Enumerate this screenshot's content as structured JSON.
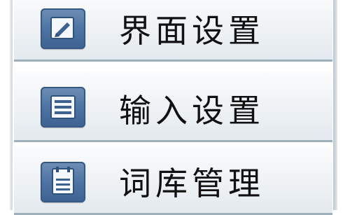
{
  "menu": {
    "items": [
      {
        "label": "界面设置",
        "icon": "edit-icon"
      },
      {
        "label": "输入设置",
        "icon": "keyboard-icon"
      },
      {
        "label": "词库管理",
        "icon": "dictionary-icon"
      }
    ]
  }
}
